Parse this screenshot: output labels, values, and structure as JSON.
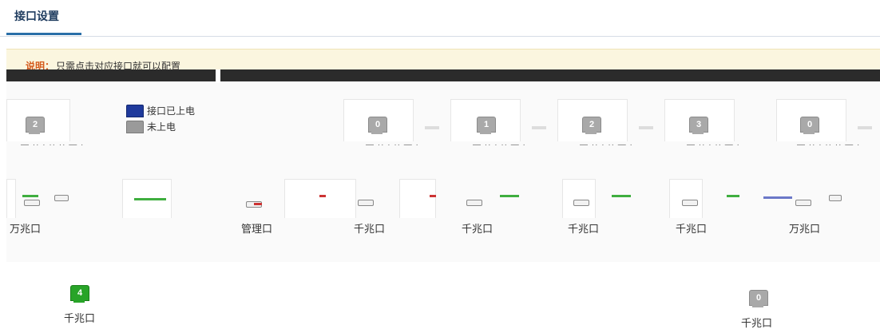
{
  "page_tab": {
    "title": "接口设置"
  },
  "notice": {
    "label": "说明：",
    "text": "只需点击对应接口就可以配置"
  },
  "legend": [
    {
      "label": "接口已上电",
      "color": "#1f3a9c"
    },
    {
      "label": "未上电",
      "color": "#9a9a9a"
    }
  ],
  "top_ports": [
    {
      "number": "2",
      "state": "off"
    },
    {
      "number": "0",
      "state": "off"
    },
    {
      "number": "1",
      "state": "off"
    },
    {
      "number": "2",
      "state": "off"
    },
    {
      "number": "3",
      "state": "off"
    },
    {
      "number": "0",
      "state": "off"
    }
  ],
  "port_types": [
    "万兆口",
    "管理口",
    "千兆口",
    "千兆口",
    "千兆口",
    "千兆口",
    "万兆口"
  ],
  "bottom_ports": [
    {
      "number": "4",
      "state": "on",
      "type": "千兆口"
    },
    {
      "number": "0",
      "state": "off",
      "type": "千兆口"
    }
  ],
  "colors": {
    "accent": "#2a6fa8",
    "powered": "#1f3a9c",
    "link_up": "#28a428",
    "unpowered": "#a9a9a9",
    "notice_label": "#d45a1c"
  }
}
